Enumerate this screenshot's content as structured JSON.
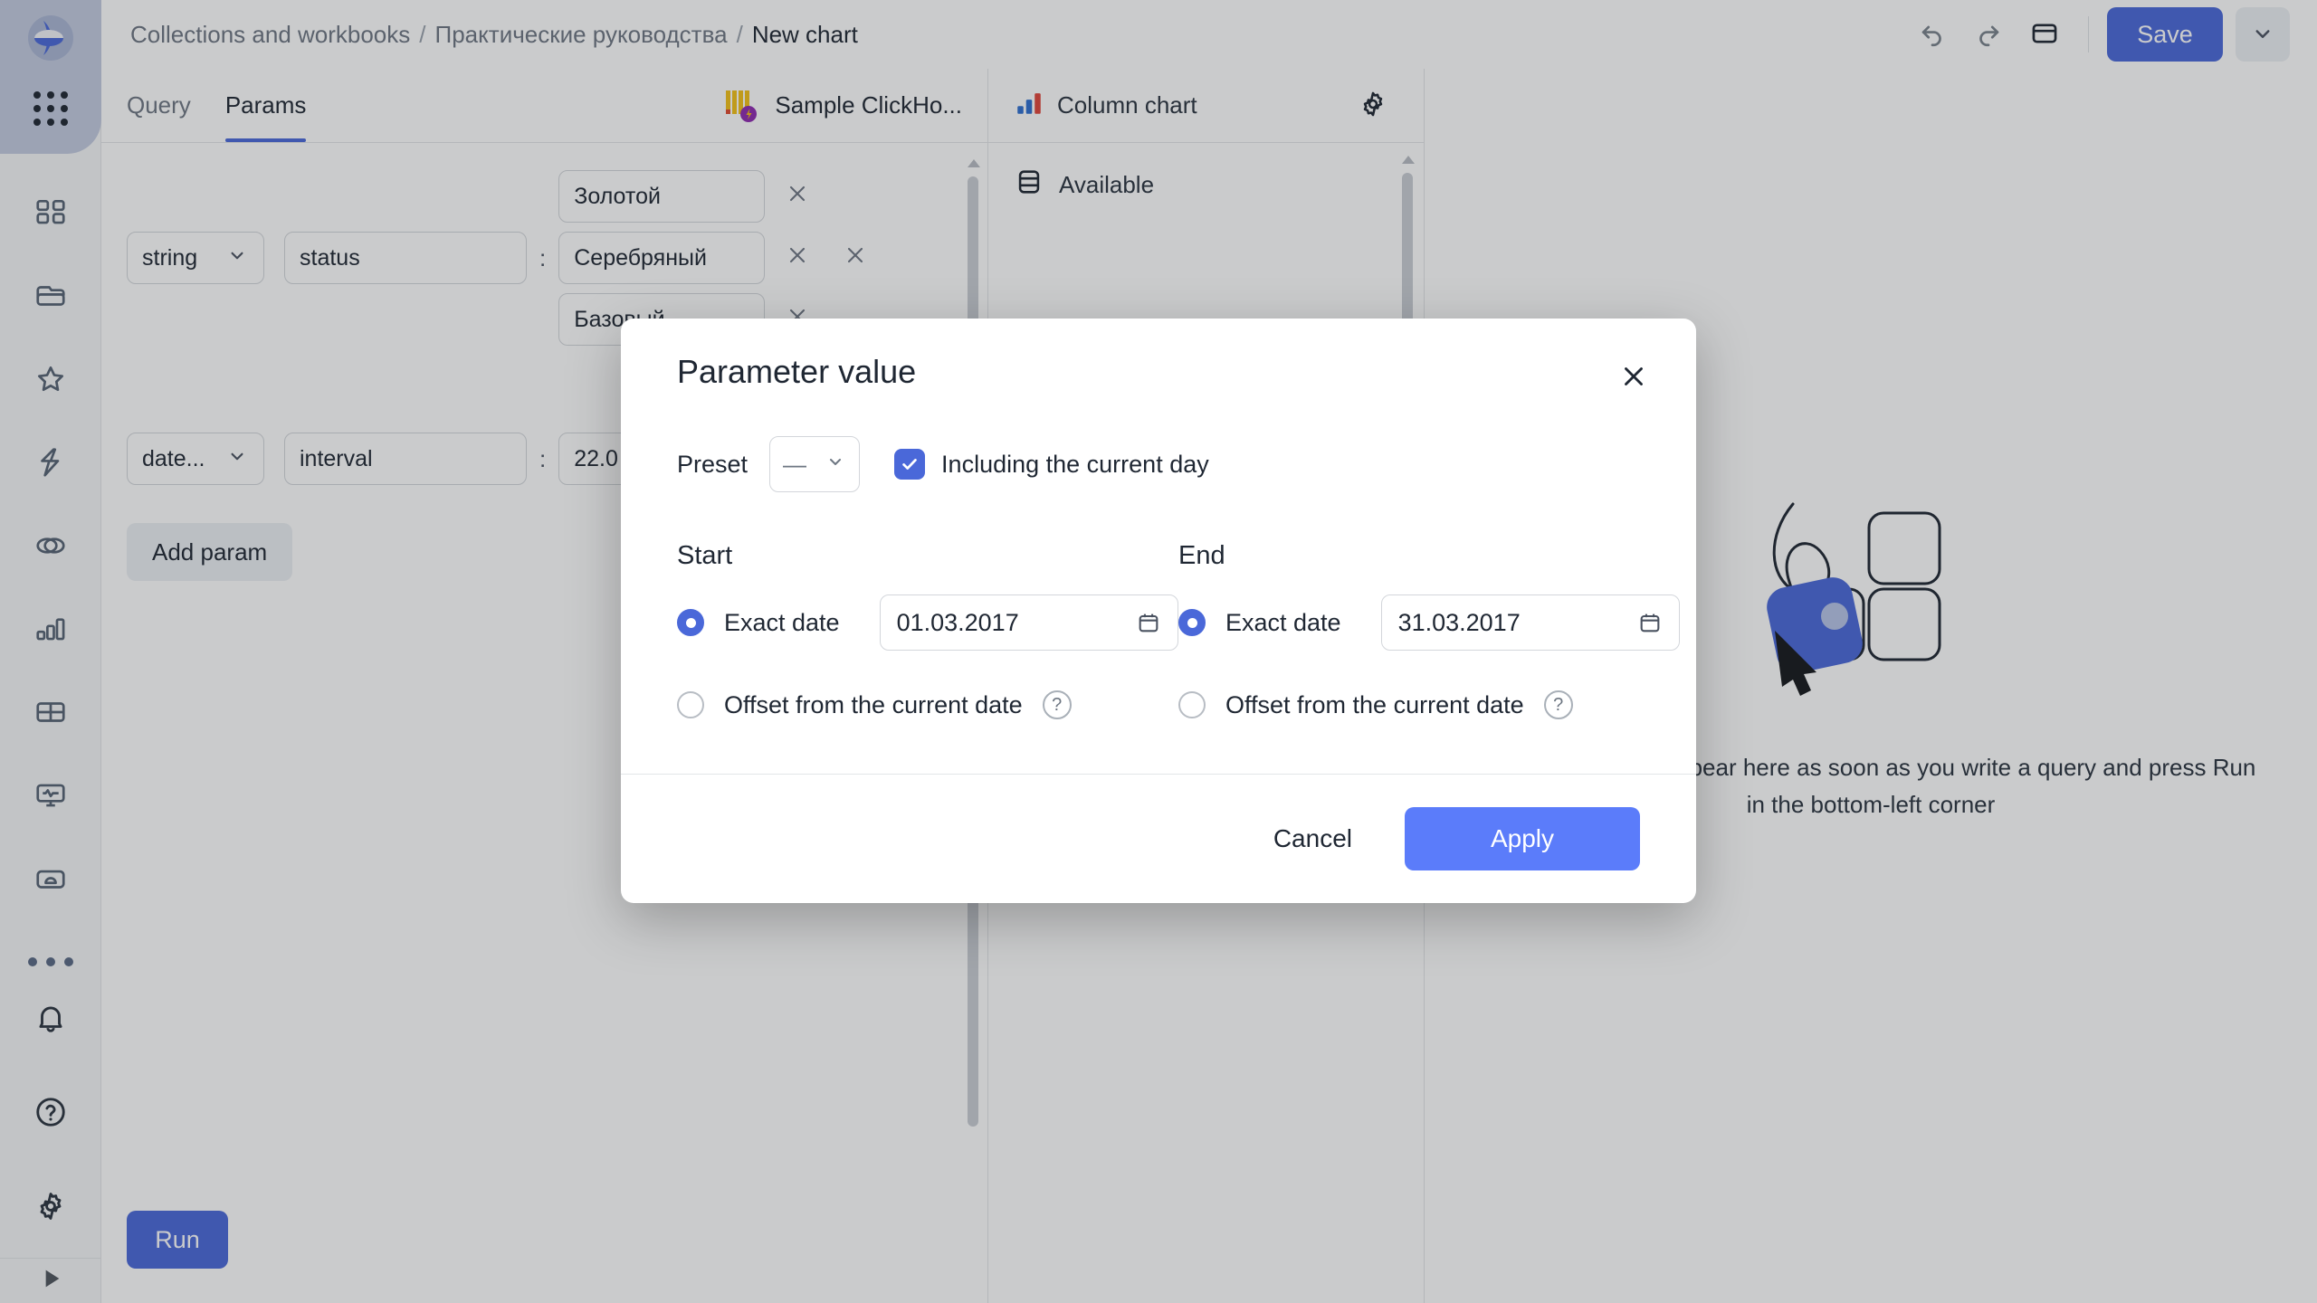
{
  "app": {
    "logo_icon": "datalens-logo-icon",
    "apps_grid_icon": "apps-grid-icon"
  },
  "header": {
    "breadcrumb": {
      "root": "Collections and workbooks",
      "workbook": "Практические руководства",
      "current": "New chart",
      "separator": "/"
    },
    "undo_icon": "undo-icon",
    "redo_icon": "redo-icon",
    "layout_icon": "panel-layout-icon",
    "save_label": "Save",
    "save_caret_icon": "chevron-down-icon"
  },
  "sidebar": {
    "items": [
      {
        "name": "sidebar-item-navigation",
        "icon": "squares-icon"
      },
      {
        "name": "sidebar-item-collections",
        "icon": "folders-icon"
      },
      {
        "name": "sidebar-item-favorites",
        "icon": "star-icon"
      },
      {
        "name": "sidebar-item-connections",
        "icon": "plug-bolt-icon"
      },
      {
        "name": "sidebar-item-datasets",
        "icon": "circles-overlap-icon"
      },
      {
        "name": "sidebar-item-charts",
        "icon": "bar-chart-icon"
      },
      {
        "name": "sidebar-item-dashboards",
        "icon": "grid-table-icon"
      },
      {
        "name": "sidebar-item-monitoring",
        "icon": "monitor-pulse-icon"
      },
      {
        "name": "sidebar-item-storage",
        "icon": "folder-cloud-icon"
      },
      {
        "name": "sidebar-item-more",
        "icon": "ellipsis-icon"
      }
    ],
    "bottom_items": [
      {
        "name": "sidebar-item-notifications",
        "icon": "bell-icon"
      },
      {
        "name": "sidebar-item-support",
        "icon": "question-circle-icon"
      },
      {
        "name": "sidebar-item-settings",
        "icon": "gear-icon"
      }
    ],
    "collapse_icon": "play-triangle-icon"
  },
  "left_pane": {
    "tabs": [
      {
        "label": "Query",
        "active": false
      },
      {
        "label": "Params",
        "active": true
      }
    ],
    "connection": {
      "label": "Sample ClickHo...",
      "icon": "clickhouse-icon"
    },
    "params": [
      {
        "type": "string",
        "type_caret_icon": "chevron-down-icon",
        "name": "status",
        "colon": ":",
        "values": [
          "Золотой",
          "Серебряный",
          "Базовый"
        ],
        "remove_value_icon": "close-x-icon",
        "remove_param_icon": "close-x-icon"
      },
      {
        "type": "date...",
        "type_caret_icon": "chevron-down-icon",
        "name": "interval",
        "colon": ":",
        "values": [
          "22.0"
        ],
        "remove_value_icon": "close-x-icon",
        "remove_param_icon": "close-x-icon"
      }
    ],
    "add_param_label": "Add param",
    "run_label": "Run",
    "scroll_up_icon": "scroll-up-arrow-icon"
  },
  "mid_pane": {
    "chart_type": "Column chart",
    "chart_type_icon": "column-chart-icon",
    "settings_icon": "gear-icon",
    "sections": [
      {
        "label": "Available",
        "icon": "dataset-fields-icon"
      }
    ]
  },
  "right_pane": {
    "placeholder_illustration": "empty-chart-illustration",
    "placeholder_text": "Visualization will appear here as soon as you write a query and press Run in the bottom-left corner"
  },
  "modal": {
    "title": "Parameter value",
    "close_icon": "close-x-icon",
    "preset_label": "Preset",
    "preset_value": "—",
    "preset_caret_icon": "chevron-down-icon",
    "including_current_day_label": "Including the current day",
    "including_current_day_checked": true,
    "check_icon": "check-icon",
    "calendar_icon": "calendar-icon",
    "help_icon": "question-mark-icon",
    "start": {
      "title": "Start",
      "exact_date_label": "Exact date",
      "exact_date_selected": true,
      "date_value": "01.03.2017",
      "offset_label": "Offset from the current date",
      "offset_selected": false
    },
    "end": {
      "title": "End",
      "exact_date_label": "Exact date",
      "exact_date_selected": true,
      "date_value": "31.03.2017",
      "offset_label": "Offset from the current date",
      "offset_selected": false
    },
    "cancel_label": "Cancel",
    "apply_label": "Apply"
  },
  "colors": {
    "accent": "#4a68d9",
    "apply_button": "#5b7cfa",
    "rail_top": "#c3cbe0",
    "scrim": "rgba(34,37,43,0.24)"
  }
}
